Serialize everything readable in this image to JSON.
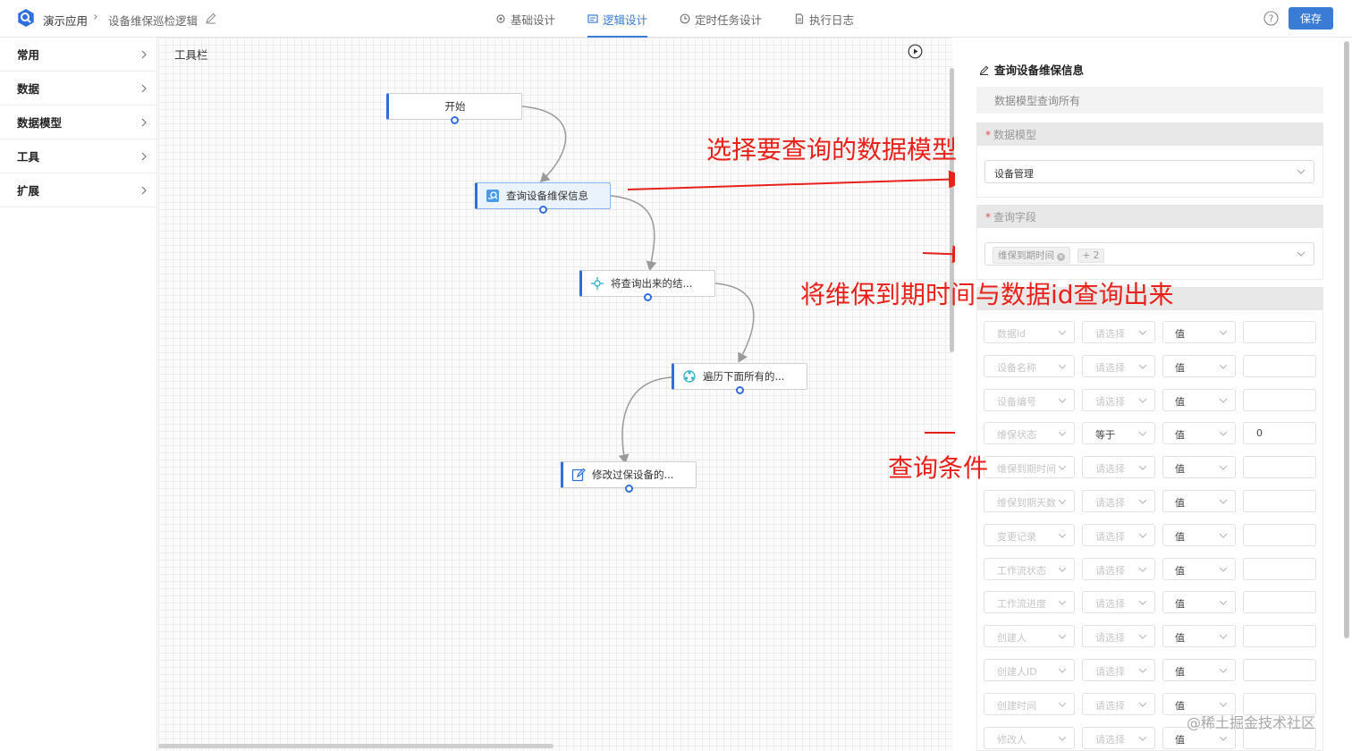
{
  "header": {
    "app_name": "演示应用",
    "breadcrumb_sep": "›",
    "page_name": "设备维保巡检逻辑",
    "tabs": [
      {
        "label": "基础设计",
        "icon": "gear-icon",
        "active": false
      },
      {
        "label": "逻辑设计",
        "icon": "logic-icon",
        "active": true
      },
      {
        "label": "定时任务设计",
        "icon": "clock-icon",
        "active": false
      },
      {
        "label": "执行日志",
        "icon": "document-icon",
        "active": false
      }
    ],
    "save_label": "保存",
    "accent": "#3a7bd5"
  },
  "sidebar": {
    "items": [
      {
        "label": "常用"
      },
      {
        "label": "数据"
      },
      {
        "label": "数据模型"
      },
      {
        "label": "工具"
      },
      {
        "label": "扩展"
      }
    ]
  },
  "canvas": {
    "toolbar_title": "工具栏",
    "nodes": [
      {
        "label": "开始"
      },
      {
        "label": "查询设备维保信息"
      },
      {
        "label": "将查询出来的结..."
      },
      {
        "label": "遍历下面所有的..."
      },
      {
        "label": "修改过保设备的..."
      }
    ]
  },
  "panel": {
    "title": "查询设备维保信息",
    "operation": "数据模型查询所有",
    "data_model": {
      "label": "数据模型",
      "value": "设备管理"
    },
    "query_fields": {
      "label": "查询字段",
      "tag": "维保到期时间",
      "more": "+ 2"
    },
    "conditions": [
      {
        "field": "数据id",
        "op": "请选择",
        "type": "值",
        "value": ""
      },
      {
        "field": "设备名称",
        "op": "请选择",
        "type": "值",
        "value": ""
      },
      {
        "field": "设备编号",
        "op": "请选择",
        "type": "值",
        "value": ""
      },
      {
        "field": "维保状态",
        "op": "等于",
        "type": "值",
        "value": "0"
      },
      {
        "field": "维保到期时间",
        "op": "请选择",
        "type": "值",
        "value": ""
      },
      {
        "field": "维保到期天数",
        "op": "请选择",
        "type": "值",
        "value": ""
      },
      {
        "field": "变更记录",
        "op": "请选择",
        "type": "值",
        "value": ""
      },
      {
        "field": "工作流状态",
        "op": "请选择",
        "type": "值",
        "value": ""
      },
      {
        "field": "工作流进度",
        "op": "请选择",
        "type": "值",
        "value": ""
      },
      {
        "field": "创建人",
        "op": "请选择",
        "type": "值",
        "value": ""
      },
      {
        "field": "创建人ID",
        "op": "请选择",
        "type": "值",
        "value": ""
      },
      {
        "field": "创建时间",
        "op": "请选择",
        "type": "值",
        "value": ""
      },
      {
        "field": "修改人",
        "op": "请选择",
        "type": "值",
        "value": ""
      }
    ]
  },
  "annotations": {
    "select_model": "选择要查询的数据模型",
    "query_fields_note": "将维保到期时间与数据id查询出来",
    "condition_note": "查询条件",
    "annotation_color": "#e8221a"
  },
  "watermark": "@稀土掘金技术社区"
}
